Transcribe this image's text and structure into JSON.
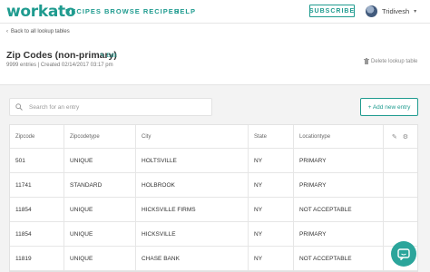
{
  "nav": {
    "logo": "workato",
    "links": [
      "RECIPES",
      "BROWSE RECIPES",
      "HELP"
    ],
    "subscribe": "SUBSCRIBE",
    "user_name": "Tridivesh",
    "brand_color": "#1f9b8f"
  },
  "header": {
    "back_link": "Back to all lookup tables",
    "title": "Zip Codes (non-primary)",
    "edit": "Edit",
    "meta": "9999 entries | Created 02/14/2017 03:17 pm",
    "delete": "Delete lookup table"
  },
  "toolbar": {
    "search_placeholder": "Search for an entry",
    "add_entry": "+ Add new entry"
  },
  "table": {
    "columns": [
      "Zipcode",
      "Zipcodetype",
      "City",
      "State",
      "Locationtype"
    ],
    "rows": [
      [
        "501",
        "UNIQUE",
        "HOLTSVILLE",
        "NY",
        "PRIMARY"
      ],
      [
        "11741",
        "STANDARD",
        "HOLBROOK",
        "NY",
        "PRIMARY"
      ],
      [
        "11854",
        "UNIQUE",
        "HICKSVILLE FIRMS",
        "NY",
        "NOT ACCEPTABLE"
      ],
      [
        "11854",
        "UNIQUE",
        "HICKSVILLE",
        "NY",
        "PRIMARY"
      ],
      [
        "11819",
        "UNIQUE",
        "CHASE BANK",
        "NY",
        "NOT ACCEPTABLE"
      ]
    ]
  },
  "icons": [
    "chevron-left-icon",
    "pencil-icon",
    "trash-icon",
    "search-icon",
    "pencil-icon",
    "gear-icon",
    "chat-icon",
    "chevron-down-icon"
  ]
}
